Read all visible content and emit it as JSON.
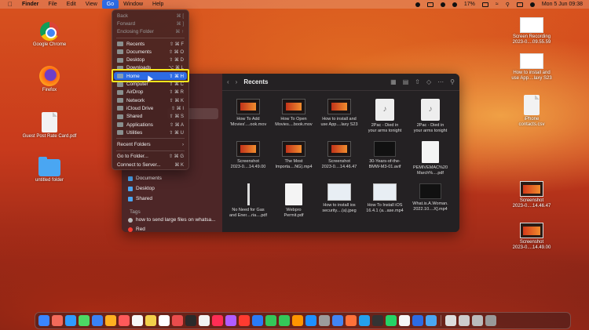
{
  "menubar": {
    "apple": "",
    "items": [
      {
        "label": "Finder",
        "bold": true,
        "active": false
      },
      {
        "label": "File",
        "bold": false,
        "active": false
      },
      {
        "label": "Edit",
        "bold": false,
        "active": false
      },
      {
        "label": "View",
        "bold": false,
        "active": false
      },
      {
        "label": "Go",
        "bold": false,
        "active": true
      },
      {
        "label": "Window",
        "bold": false,
        "active": false
      },
      {
        "label": "Help",
        "bold": false,
        "active": false
      }
    ],
    "battery": "17%",
    "datetime": "Mon 5 Jun  09:38"
  },
  "desktop_left": [
    {
      "label": "Google Chrome",
      "icon": "chrome-icon"
    },
    {
      "label": "Firefox",
      "icon": "firefox-icon"
    },
    {
      "label": "Guest Post Rate Card.pdf",
      "icon": "pdf-file-icon"
    },
    {
      "label": "untitled folder",
      "icon": "folder-icon"
    }
  ],
  "desktop_right": [
    {
      "label1": "Screen Recording",
      "label2": "2023-0....09.55.59",
      "icon": "screenshot-icon"
    },
    {
      "label1": "How to install and",
      "label2": "use App....laxy S23",
      "icon": "video-file-icon"
    },
    {
      "label1": "iPhone",
      "label2": "contacts.csv",
      "icon": "csv-file-icon"
    },
    {
      "label1": "Screenshot",
      "label2": "2023-0....14.46.47",
      "icon": "screenshot-icon"
    },
    {
      "label1": "Screenshot",
      "label2": "2023-0....14.49.00",
      "icon": "screenshot-icon"
    }
  ],
  "go_menu": {
    "items": [
      {
        "label": "Back",
        "shortcut": "⌘ [",
        "disabled": true
      },
      {
        "label": "Forward",
        "shortcut": "⌘ ]",
        "disabled": true
      },
      {
        "label": "Enclosing Folder",
        "shortcut": "⌘ ↑",
        "disabled": true
      },
      {
        "sep": true
      },
      {
        "label": "Recents",
        "shortcut": "⇧ ⌘ F"
      },
      {
        "label": "Documents",
        "shortcut": "⇧ ⌘ O"
      },
      {
        "label": "Desktop",
        "shortcut": "⇧ ⌘ D"
      },
      {
        "label": "Downloads",
        "shortcut": "⌥ ⌘ L"
      },
      {
        "label": "Home",
        "shortcut": "⇧ ⌘ H",
        "highlight": true
      },
      {
        "label": "Computer",
        "shortcut": "⇧ ⌘ C"
      },
      {
        "label": "AirDrop",
        "shortcut": "⇧ ⌘ R"
      },
      {
        "label": "Network",
        "shortcut": "⇧ ⌘ K"
      },
      {
        "label": "iCloud Drive",
        "shortcut": "⇧ ⌘ I"
      },
      {
        "label": "Shared",
        "shortcut": "⇧ ⌘ S"
      },
      {
        "label": "Applications",
        "shortcut": "⇧ ⌘ A"
      },
      {
        "label": "Utilities",
        "shortcut": "⇧ ⌘ U"
      },
      {
        "sep": true
      },
      {
        "label": "Recent Folders",
        "shortcut": "›"
      },
      {
        "sep": true
      },
      {
        "label": "Go to Folder...",
        "shortcut": "⇧ ⌘ G"
      },
      {
        "label": "Connect to Server...",
        "shortcut": "⌘ K"
      }
    ]
  },
  "finder": {
    "title": "Recents",
    "sidebar": {
      "items": [
        "Documents",
        "Desktop",
        "Shared"
      ],
      "tags_label": "Tags",
      "tags": [
        "how to send large files on whatsa...",
        "Red"
      ]
    },
    "files": [
      {
        "l1": "How To Add",
        "l2": "'Movies'....ook.mov",
        "kind": "video"
      },
      {
        "l1": "How To Open",
        "l2": "Movies....book.mov",
        "kind": "video"
      },
      {
        "l1": "How to install and",
        "l2": "use App....laxy S23",
        "kind": "video"
      },
      {
        "l1": "2Pac - Died in",
        "l2": "your arms tonight",
        "kind": "audio"
      },
      {
        "l1": "2Pac - Died in",
        "l2": "your arms tonight",
        "kind": "audio"
      },
      {
        "l1": "Screenshot",
        "l2": "2023-0....14.49.00",
        "kind": "video"
      },
      {
        "l1": "The Most",
        "l2": "Importa....NG).mp4",
        "kind": "video"
      },
      {
        "l1": "Screenshot",
        "l2": "2023-0....14.46.47",
        "kind": "video"
      },
      {
        "l1": "30-Years-of-the-",
        "l2": "BMW-M3-01.avif",
        "kind": "blackimg"
      },
      {
        "l1": "PEMIVEMAC%20",
        "l2": "March%....pdf",
        "kind": "doc"
      },
      {
        "l1": "No Need for Gas",
        "l2": "and Ener....ria....pdf",
        "kind": "bar"
      },
      {
        "l1": "Webpro",
        "l2": "Permit.pdf",
        "kind": "doc"
      },
      {
        "l1": "How to install ios",
        "l2": "security....(a).jpeg",
        "kind": "shotw"
      },
      {
        "l1": "How To Install iOS",
        "l2": "16.4.1 (a...ase.mp4",
        "kind": "shotw"
      },
      {
        "l1": "What.is.A.Woman.",
        "l2": "2022.10....X].mp4",
        "kind": "blackimg"
      }
    ]
  },
  "dock": {
    "colors": [
      "#3a86ff",
      "#f36a5a",
      "#2f9bff",
      "#4cd964",
      "#3b82f6",
      "#ffb020",
      "#ff5a5a",
      "#f7f7f7",
      "#f3d04a",
      "#ffffff",
      "#e94c4c",
      "#2a2a2a",
      "#f2f2f2",
      "#ff2d55",
      "#b15cff",
      "#ff3b30",
      "#2a7bf7",
      "#34c759",
      "#34c759",
      "#ff9500",
      "#1e90ff",
      "#9c9c9c",
      "#4285f4",
      "#ff7139",
      "#24a0ed",
      "#333333",
      "#25d366",
      "#f6f6f6",
      "#2d6be4",
      "#4aa6f2",
      "#dddddd",
      "#cccccc",
      "#bbbbbb",
      "#999999"
    ]
  }
}
